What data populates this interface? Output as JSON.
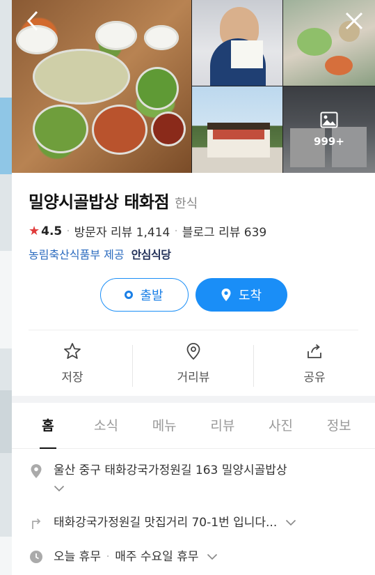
{
  "photos": {
    "more_count": "999+"
  },
  "place": {
    "name": "밀양시골밥상 태화점",
    "category": "한식",
    "rating": "4.5",
    "visitor_review": "방문자 리뷰 1,414",
    "blog_review": "블로그 리뷰 639",
    "cert_provider": "농림축산식품부 제공",
    "cert_badge": "안심식당"
  },
  "actions": {
    "start": "출발",
    "arrive": "도착"
  },
  "utilities": [
    {
      "label": "저장",
      "icon": "star-outline-icon"
    },
    {
      "label": "거리뷰",
      "icon": "pin-outline-icon"
    },
    {
      "label": "공유",
      "icon": "share-icon"
    }
  ],
  "tabs": [
    "홈",
    "소식",
    "메뉴",
    "리뷰",
    "사진",
    "정보"
  ],
  "details": {
    "address": "울산 중구 태화강국가정원길 163 밀양시골밥상",
    "directions": "태화강국가정원길 맛집거리 70-1번 입니다...",
    "hours_status": "오늘 휴무",
    "hours_note": "매주 수요일 휴무"
  },
  "colors": {
    "accent": "#1a8ef7",
    "star": "#e03a3a",
    "link": "#2b6bbf"
  }
}
